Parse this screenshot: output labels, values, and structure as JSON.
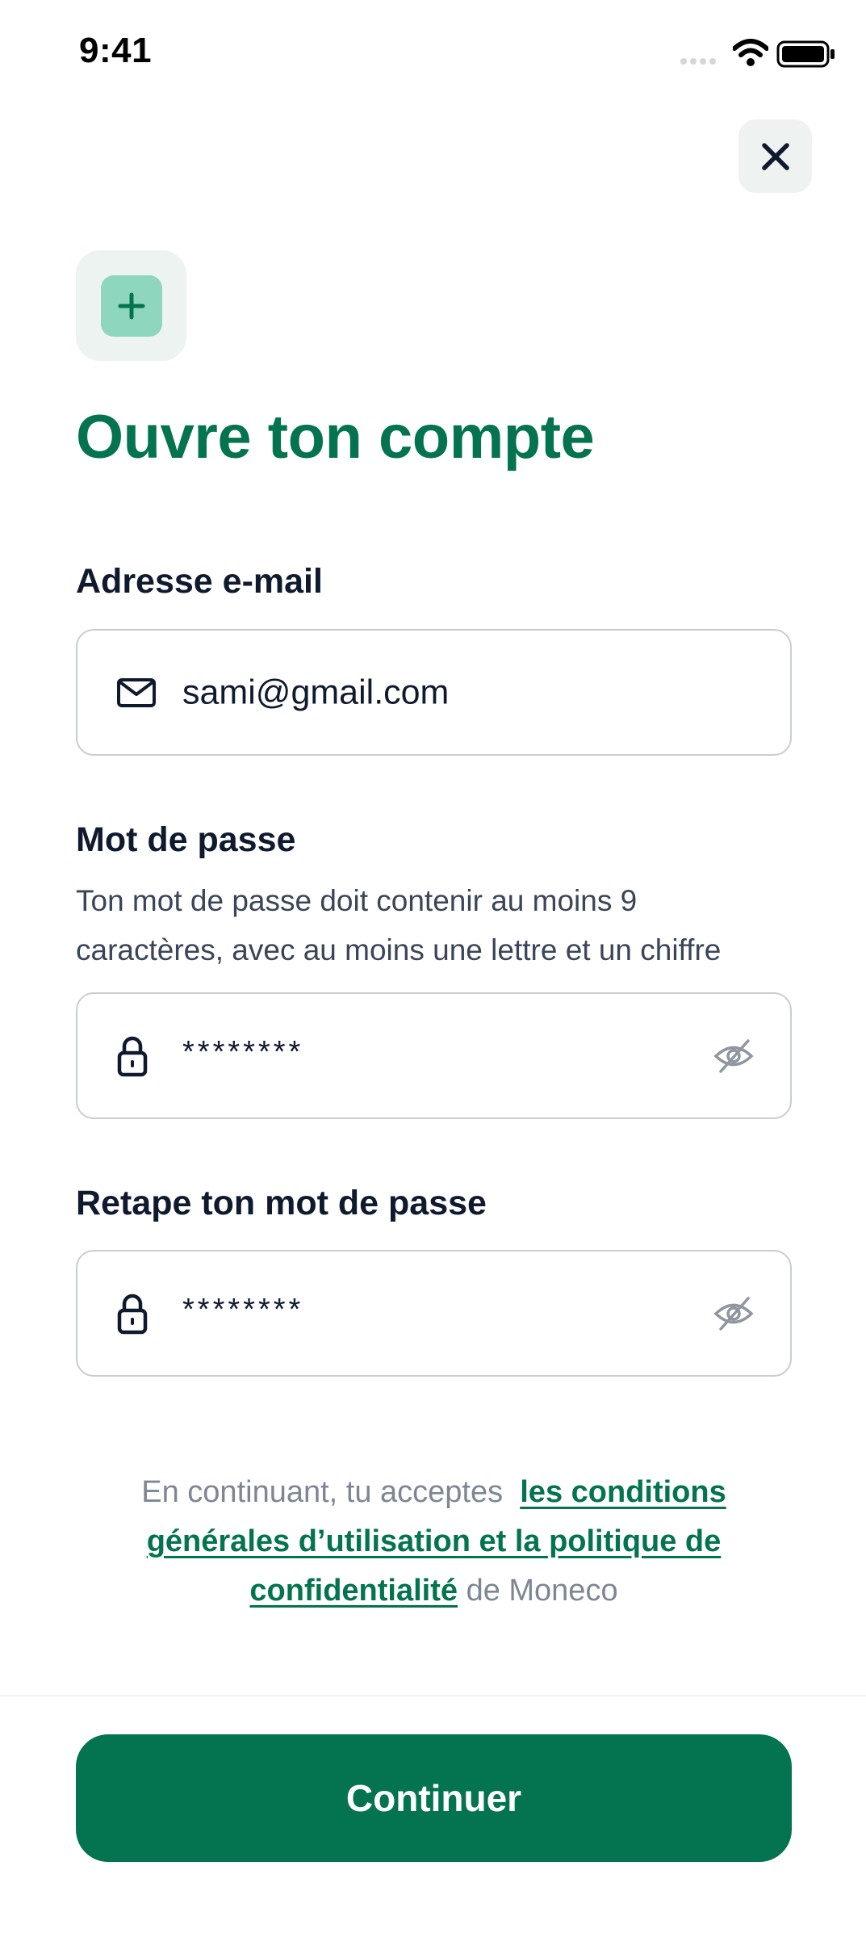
{
  "status_bar": {
    "time": "9:41"
  },
  "header": {
    "title": "Ouvre ton compte"
  },
  "form": {
    "email": {
      "label": "Adresse e-mail",
      "value": "sami@gmail.com"
    },
    "password": {
      "label": "Mot de passe",
      "hint_line1": "Ton mot de passe doit contenir au moins 9",
      "hint_line2": "caractères, avec au moins une lettre et un chiffre",
      "value": "********"
    },
    "confirm_password": {
      "label": "Retape ton mot de passe",
      "value": "********"
    }
  },
  "legal": {
    "prefix": "En continuant, tu acceptes",
    "link_line1": "les conditions",
    "link_line2": "générales d’utilisation et la politique de",
    "link_line3": "confidentialité",
    "suffix": "de Moneco"
  },
  "footer": {
    "continue_label": "Continuer"
  },
  "colors": {
    "brand": "#04734f",
    "badge_fill": "#8fd6be",
    "text": "#0f1a2e"
  },
  "icons": [
    "signal-icon",
    "wifi-icon",
    "battery-icon",
    "close-icon",
    "plus-icon",
    "mail-icon",
    "lock-icon",
    "eye-off-icon"
  ]
}
